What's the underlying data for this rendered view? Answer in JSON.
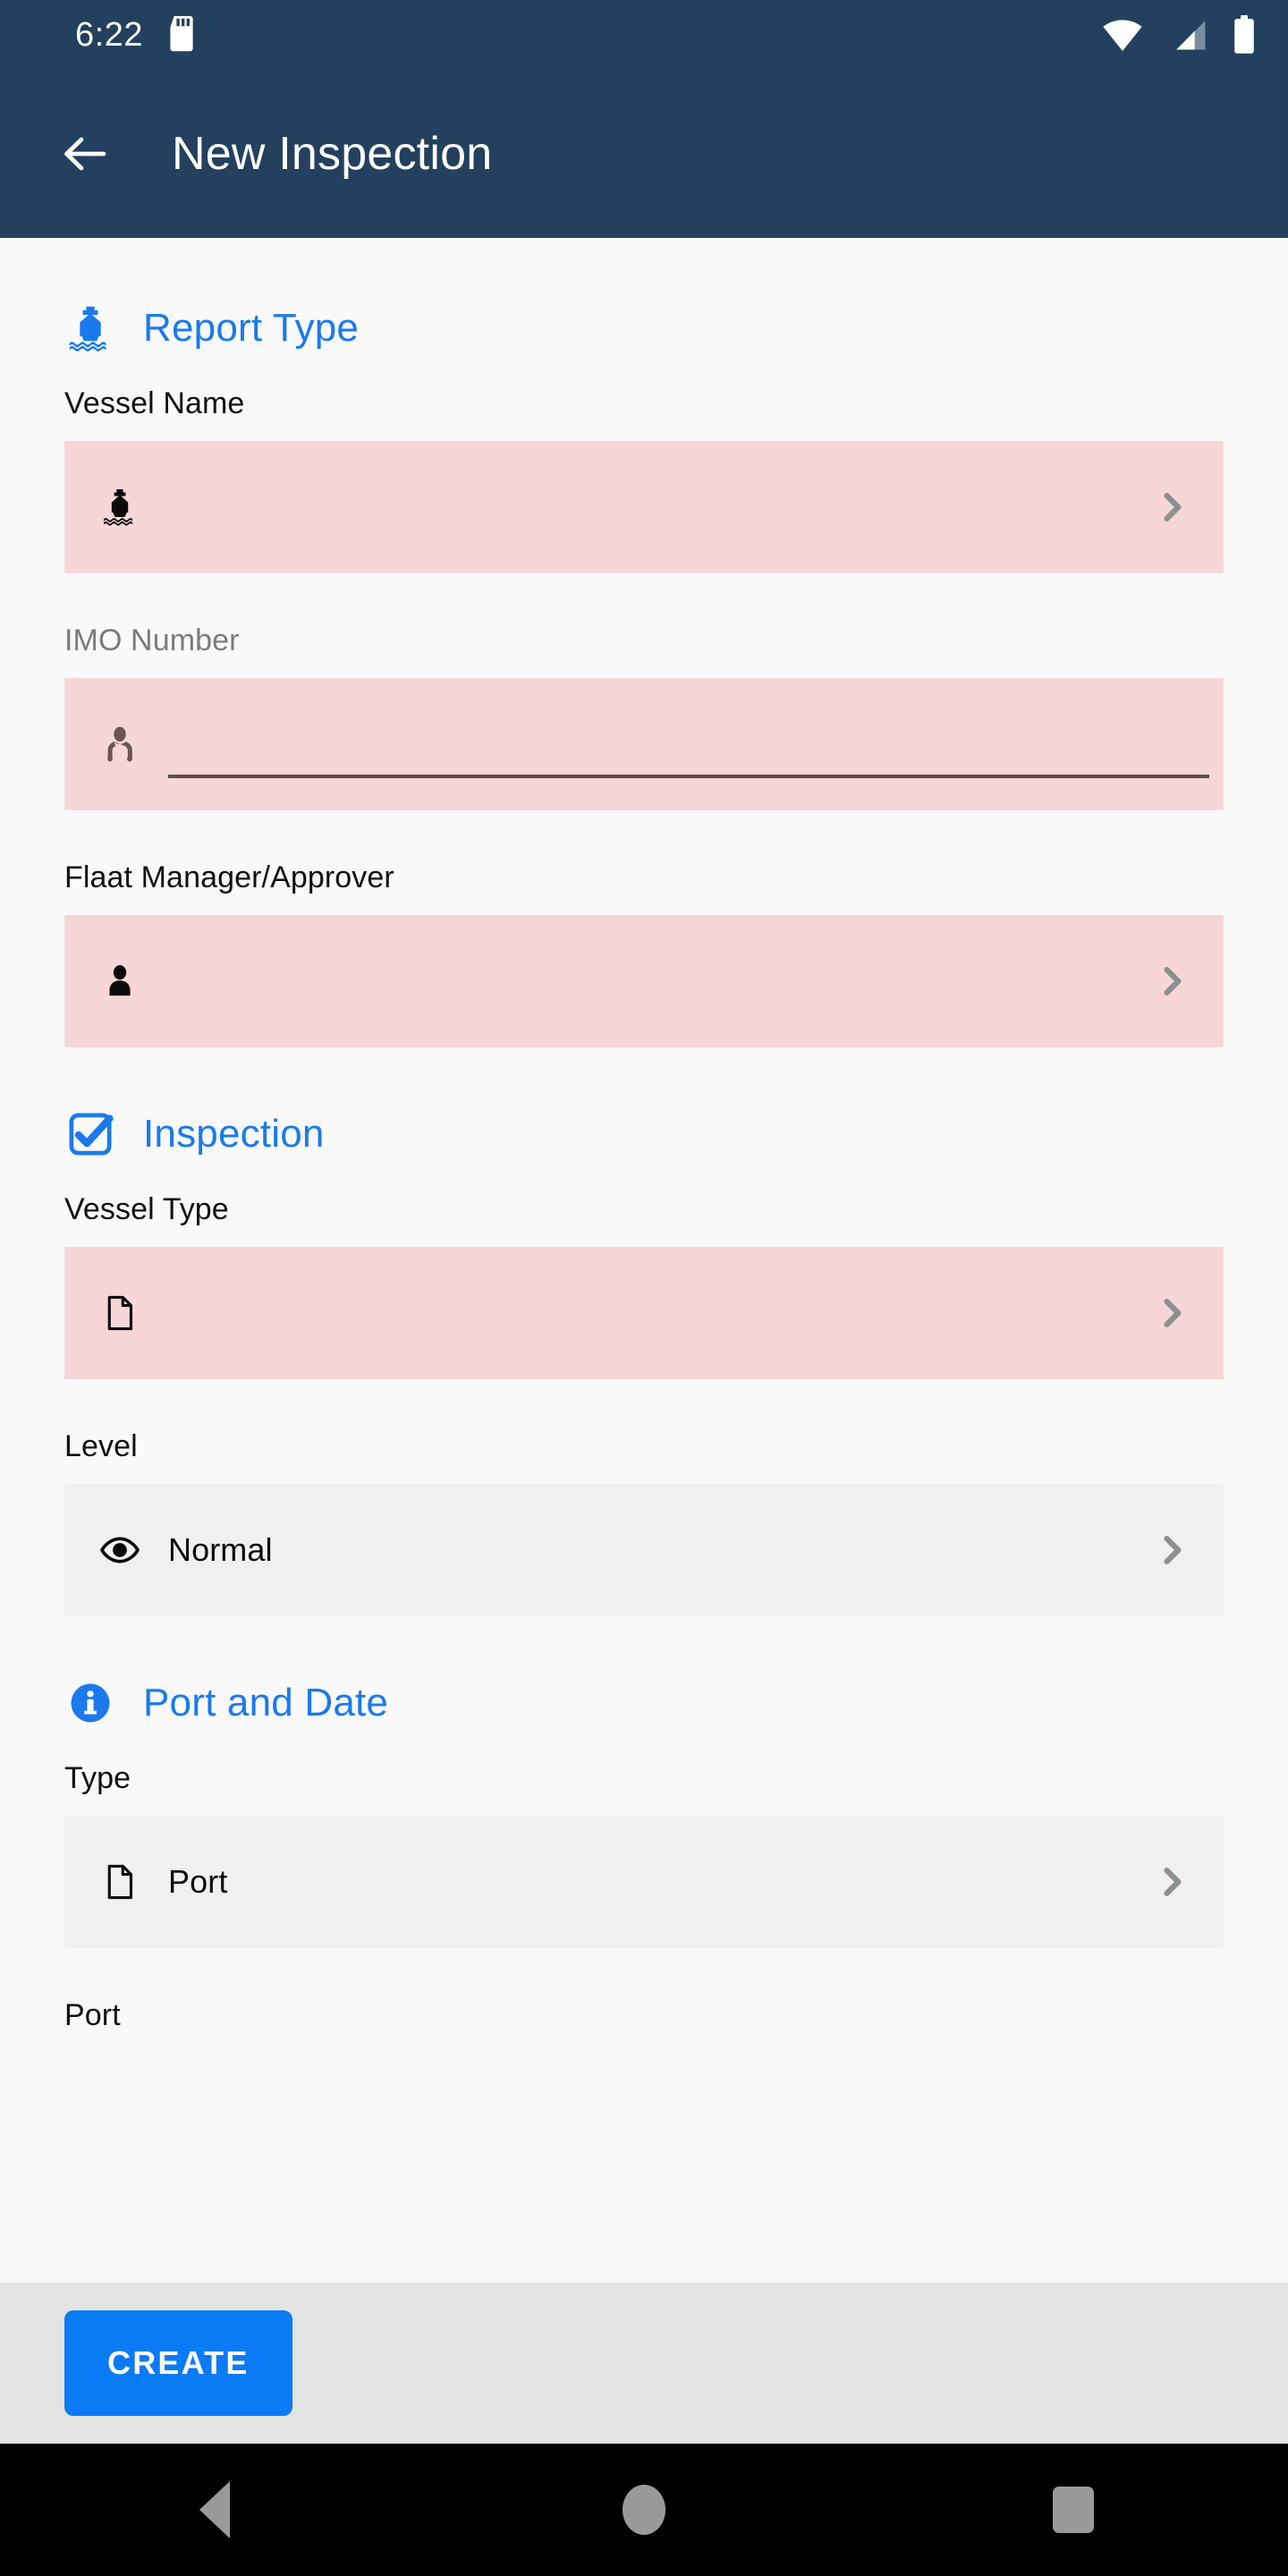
{
  "status_bar": {
    "time": "6:22",
    "left_icons": [
      "sd-card-icon"
    ],
    "right_icons": [
      "wifi-icon",
      "cellular-signal-icon",
      "battery-icon"
    ],
    "background_color": "#23405e"
  },
  "app_bar": {
    "back_icon": "arrow-left-icon",
    "title": "New Inspection",
    "background_color": "#23405e",
    "text_color": "#ffffff"
  },
  "theme": {
    "accent_blue": "#1a7aed",
    "error_field_bg": "#f6d6d6",
    "normal_field_bg": "#f0f0f0",
    "page_bg": "#f9f9f9",
    "footer_bg": "#e3e3e3",
    "create_button_bg": "#0b7bf5"
  },
  "sections": [
    {
      "icon": "ship-icon",
      "title": "Report Type",
      "fields": [
        {
          "label": "Vessel Name",
          "label_state": "normal",
          "lead_icon": "ship-icon",
          "value": "",
          "state": "error",
          "control": "picker",
          "trailing_icon": "chevron-right-icon"
        },
        {
          "label": "IMO Number",
          "label_state": "muted",
          "lead_icon": "person-stethoscope-icon",
          "value": "",
          "placeholder": "",
          "state": "error",
          "control": "text-input"
        },
        {
          "label": "Flaat Manager/Approver",
          "label_state": "normal",
          "lead_icon": "person-icon",
          "value": "",
          "state": "error",
          "control": "picker",
          "trailing_icon": "chevron-right-icon"
        }
      ]
    },
    {
      "icon": "checkbox-checked-icon",
      "title": "Inspection",
      "fields": [
        {
          "label": "Vessel Type",
          "label_state": "normal",
          "lead_icon": "document-icon",
          "value": "",
          "state": "error",
          "control": "picker",
          "trailing_icon": "chevron-right-icon"
        },
        {
          "label": "Level",
          "label_state": "normal",
          "lead_icon": "eye-icon",
          "value": "Normal",
          "state": "normal",
          "control": "picker",
          "trailing_icon": "chevron-right-icon"
        }
      ]
    },
    {
      "icon": "info-icon",
      "title": "Port and Date",
      "fields": [
        {
          "label": "Type",
          "label_state": "normal",
          "lead_icon": "document-icon",
          "value": "Port",
          "state": "normal",
          "control": "picker",
          "trailing_icon": "chevron-right-icon"
        },
        {
          "label": "Port",
          "label_state": "normal",
          "cut_off": true
        }
      ]
    }
  ],
  "footer": {
    "create_label": "CREATE"
  },
  "nav_bar": {
    "back": "nav-back-icon",
    "home": "nav-home-icon",
    "recents": "nav-recents-icon"
  }
}
